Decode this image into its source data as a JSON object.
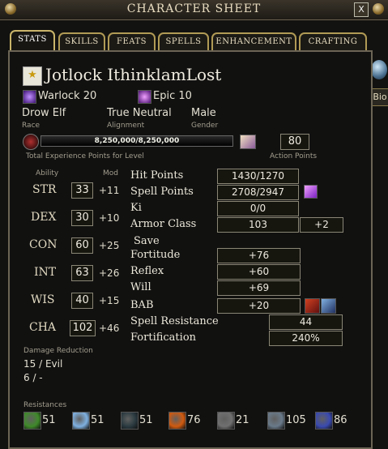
{
  "window": {
    "title": "CHARACTER SHEET",
    "close": "X"
  },
  "tabs": [
    "STATS",
    "SKILLS",
    "FEATS",
    "SPELLS",
    "ENHANCEMENT",
    "CRAFTING"
  ],
  "side": {
    "bio": "Bio"
  },
  "character": {
    "name": "Jotlock IthinklamLost",
    "class1": "Warlock 20",
    "class2": "Epic 10",
    "race": "Drow Elf",
    "race_label": "Race",
    "alignment": "True Neutral",
    "alignment_label": "Alignment",
    "gender": "Male",
    "gender_label": "Gender"
  },
  "xp": {
    "text": "8,250,000/8,250,000",
    "label": "Total Experience Points for Level",
    "progress": 1.0
  },
  "action_points": {
    "value": "80",
    "label": "Action Points"
  },
  "abilities_header": {
    "ability": "Ability",
    "mod": "Mod"
  },
  "abilities": [
    {
      "name": "STR",
      "value": "33",
      "mod": "+11"
    },
    {
      "name": "DEX",
      "value": "30",
      "mod": "+10"
    },
    {
      "name": "CON",
      "value": "60",
      "mod": "+25"
    },
    {
      "name": "INT",
      "value": "63",
      "mod": "+26"
    },
    {
      "name": "WIS",
      "value": "40",
      "mod": "+15"
    },
    {
      "name": "CHA",
      "value": "102",
      "mod": "+46"
    }
  ],
  "stats": {
    "hp_label": "Hit Points",
    "hp": "1430/1270",
    "sp_label": "Spell Points",
    "sp": "2708/2947",
    "ki_label": "Ki",
    "ki": "0/0",
    "ac_label": "Armor Class",
    "ac": "103",
    "ac_bonus": "+2",
    "save_label": "Save",
    "fort_label": "Fortitude",
    "fort": "+76",
    "reflex_label": "Reflex",
    "reflex": "+60",
    "will_label": "Will",
    "will": "+69",
    "bab_label": "BAB",
    "bab": "+20",
    "sr_label": "Spell Resistance",
    "sr": "44",
    "fortif_label": "Fortification",
    "fortif": "240%"
  },
  "damage_reduction": {
    "label": "Damage Reduction",
    "line1": "15 / Evil",
    "line2": "6 / -"
  },
  "resistances": {
    "label": "Resistances",
    "items": [
      {
        "icon": "acid-icon",
        "value": "51",
        "color": "#3f8a2a"
      },
      {
        "icon": "cold-icon",
        "value": "51",
        "color": "#7fb0e0"
      },
      {
        "icon": "electric-icon",
        "value": "51",
        "color": "#2a3a40"
      },
      {
        "icon": "fire-icon",
        "value": "76",
        "color": "#d05a10"
      },
      {
        "icon": "sonic-icon",
        "value": "21",
        "color": "#707070"
      },
      {
        "icon": "shield-icon",
        "value": "105",
        "color": "#6a7a8a"
      },
      {
        "icon": "holy-shield-icon",
        "value": "86",
        "color": "#3a4ab0"
      }
    ]
  }
}
